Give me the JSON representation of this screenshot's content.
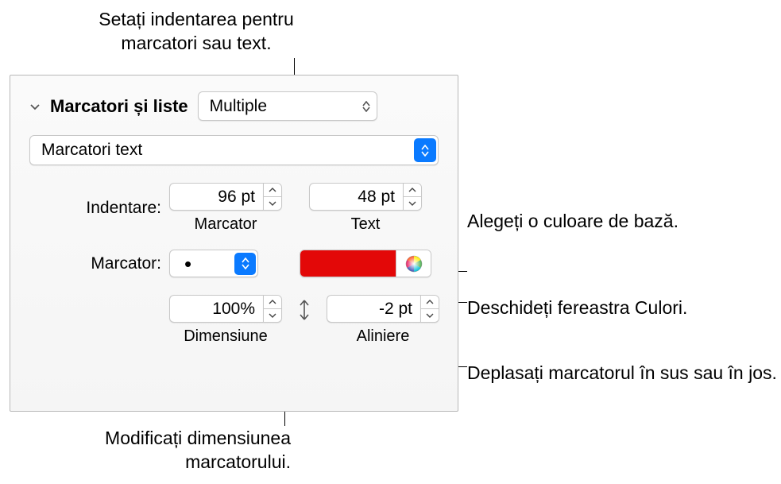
{
  "callouts": {
    "top": "Setați indentarea pentru marcatori sau text.",
    "right1": "Alegeți o culoare de bază.",
    "right2": "Deschideți fereastra Culori.",
    "right3": "Deplasați marcatorul în sus sau în jos.",
    "bottom": "Modificați dimensiunea marcatorului."
  },
  "panel": {
    "section_title": "Marcatori și liste",
    "style_popup": "Multiple",
    "type_popup": "Marcatori text",
    "indent_label": "Indentare:",
    "indent_marcator_value": "96 pt",
    "indent_marcator_sublabel": "Marcator",
    "indent_text_value": "48 pt",
    "indent_text_sublabel": "Text",
    "marcator_label": "Marcator:",
    "marcator_bullet": "•",
    "size_value": "100%",
    "size_sublabel": "Dimensiune",
    "align_value": "-2 pt",
    "align_sublabel": "Aliniere",
    "color_swatch": "#e30808"
  }
}
